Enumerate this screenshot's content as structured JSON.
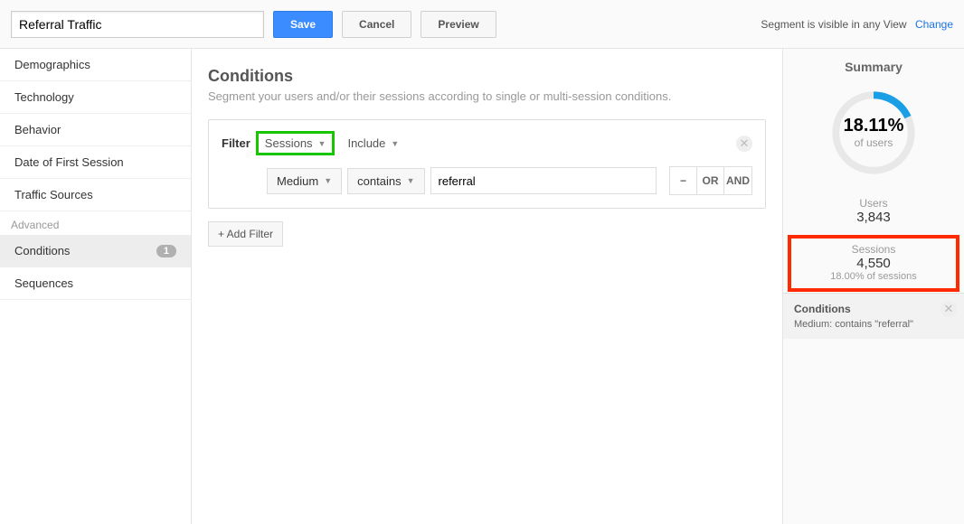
{
  "topbar": {
    "segment_name": "Referral Traffic",
    "save": "Save",
    "cancel": "Cancel",
    "preview": "Preview",
    "visibility_text": "Segment is visible in any View",
    "change": "Change"
  },
  "sidebar": {
    "items": [
      "Demographics",
      "Technology",
      "Behavior",
      "Date of First Session",
      "Traffic Sources"
    ],
    "advanced_label": "Advanced",
    "conditions_label": "Conditions",
    "conditions_badge": "1",
    "sequences_label": "Sequences"
  },
  "main": {
    "title": "Conditions",
    "desc": "Segment your users and/or their sessions according to single or multi-session conditions.",
    "filter_label": "Filter",
    "scope_dd": "Sessions",
    "include_dd": "Include",
    "dimension_dd": "Medium",
    "match_dd": "contains",
    "value_input": "referral",
    "op_minus": "−",
    "op_or": "OR",
    "op_and": "AND",
    "add_filter": "+ Add Filter"
  },
  "summary": {
    "title": "Summary",
    "donut_pct": "18.11%",
    "donut_sub": "of users",
    "users_label": "Users",
    "users_value": "3,843",
    "sessions_label": "Sessions",
    "sessions_value": "4,550",
    "sessions_sub": "18.00% of sessions",
    "cond_title": "Conditions",
    "cond_body": "Medium: contains \"referral\""
  },
  "chart_data": {
    "type": "pie",
    "title": "Users percentage",
    "series": [
      {
        "name": "segment",
        "value": 18.11
      },
      {
        "name": "remainder",
        "value": 81.89
      }
    ],
    "colors": {
      "segment": "#1a9ee6",
      "remainder": "#e8e8e8"
    }
  }
}
